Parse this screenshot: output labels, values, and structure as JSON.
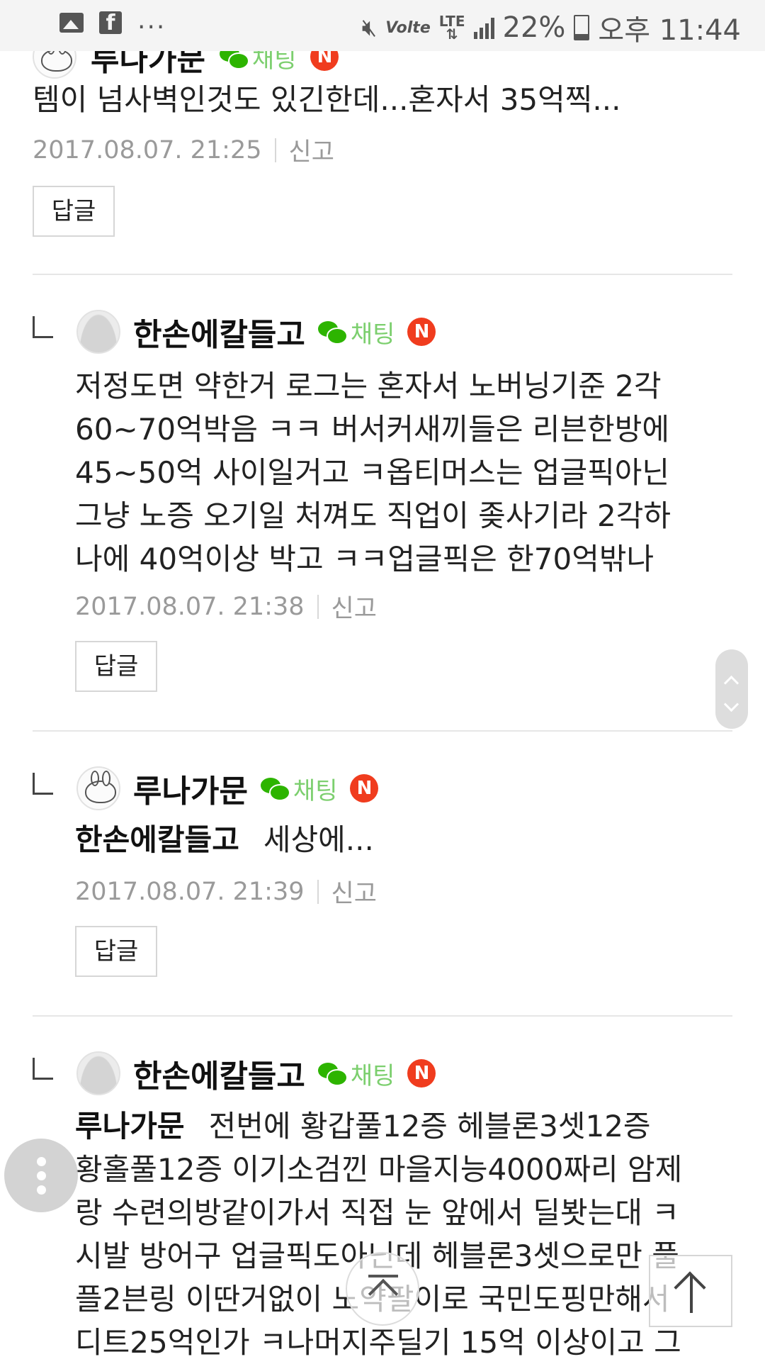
{
  "status_bar": {
    "dots": "...",
    "network_volte": "Volte",
    "network_lte": "LTE",
    "battery_percent": "22%",
    "time": "오후 11:44",
    "icons": [
      "image-icon",
      "facebook-icon",
      "mute-icon",
      "signal-icon",
      "battery-icon"
    ]
  },
  "comments": [
    {
      "author": "루나가문",
      "chat_label": "채팅",
      "badge": "N",
      "text": "템이 넘사벽인것도 있긴한데...혼자서 35억찍...",
      "date": "2017.08.07. 21:25",
      "report": "신고",
      "reply_label": "답글"
    },
    {
      "author": "한손에칼들고",
      "chat_label": "채팅",
      "badge": "N",
      "lines": [
        "저정도면 약한거 로그는 혼자서 노버닝기준 2각",
        "60~70억박음 ㅋㅋ 버서커새끼들은 리븐한방에",
        "45~50억 사이일거고 ㅋ옵티머스는 업글픽아닌",
        "그냥 노증 오기일 처껴도 직업이 좆사기라 2각하",
        "나에 40억이상 박고 ㅋㅋ업글픽은 한70억밖나"
      ],
      "date": "2017.08.07. 21:38",
      "report": "신고",
      "reply_label": "답글"
    },
    {
      "author": "루나가문",
      "chat_label": "채팅",
      "badge": "N",
      "mention": "한손에칼들고",
      "text": "세상에...",
      "date": "2017.08.07. 21:39",
      "report": "신고",
      "reply_label": "답글"
    },
    {
      "author": "한손에칼들고",
      "chat_label": "채팅",
      "badge": "N",
      "mention": "루나가문",
      "first_line": "전번에 황갑풀12증 헤블론3셋12증",
      "lines": [
        "황홀풀12증 이기소검낀 마을지능4000짜리 암제",
        "랑 수련의방같이가서 직접 눈 앞에서 딜봣는대 ㅋ",
        "시발 방어구 업글픽도아닌데 헤블론3셋으로만 풀",
        "플2븐링 이딴거없이 노약팔이로 국민도핑만해서",
        "디트25억인가 ㅋ나머지주딜기 15억 이상이고 그"
      ]
    }
  ]
}
